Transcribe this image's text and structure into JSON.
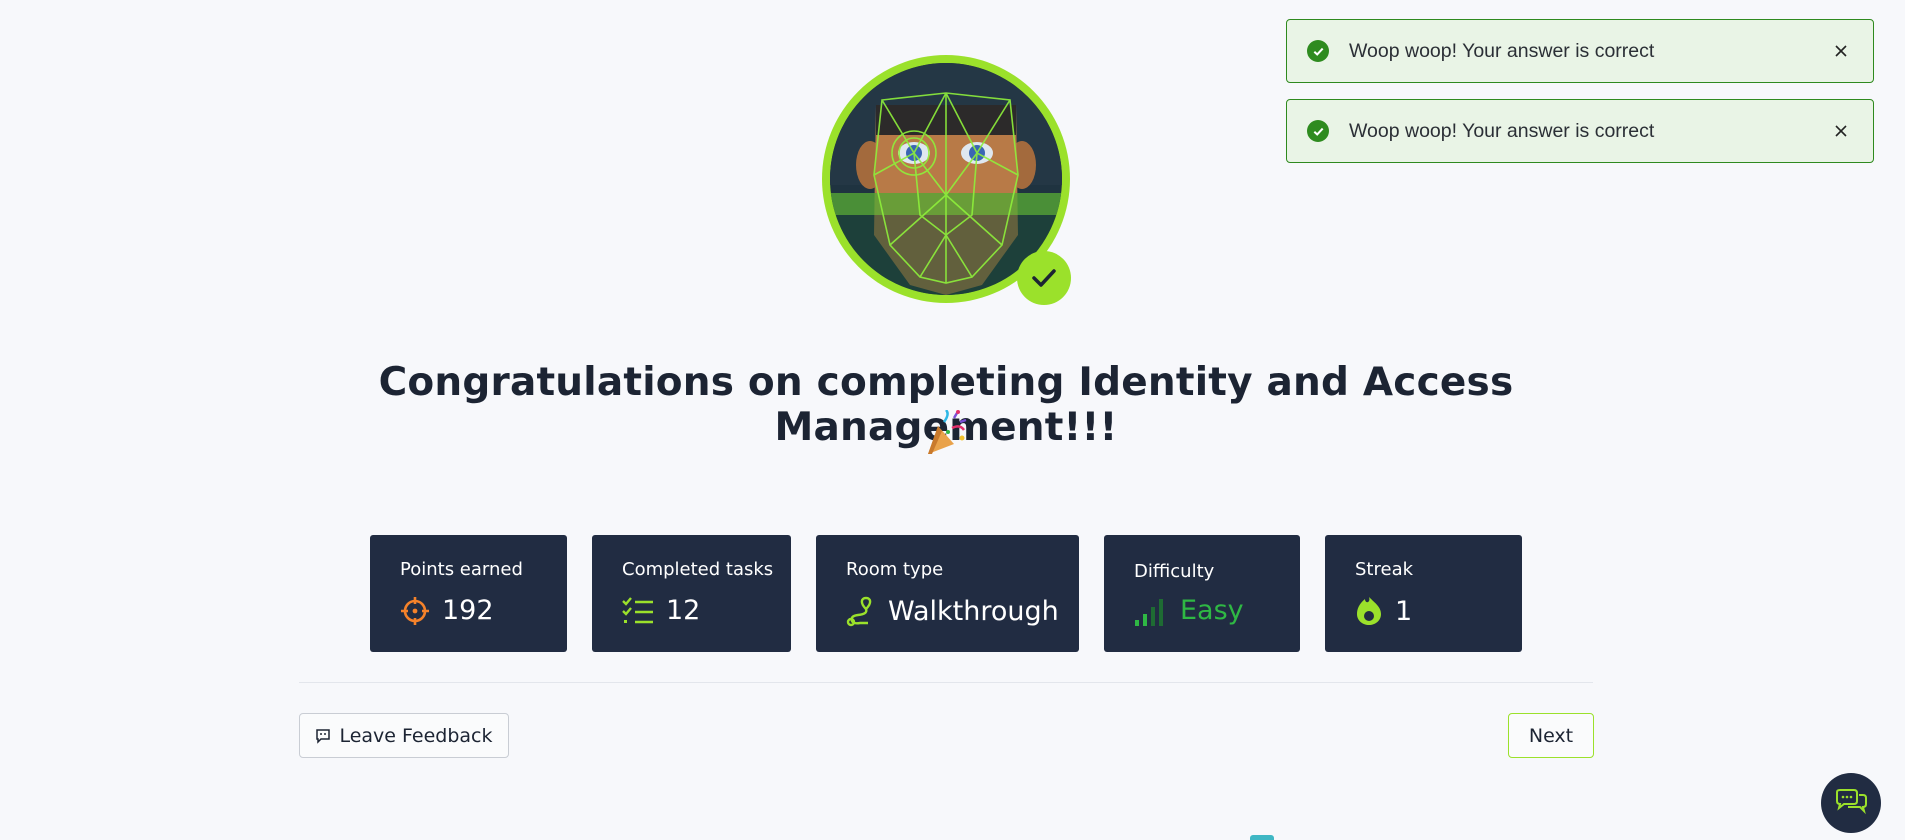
{
  "toasts": [
    {
      "message": "Woop woop! Your answer is correct"
    },
    {
      "message": "Woop woop! Your answer is correct"
    }
  ],
  "title": "Congratulations on completing Identity and Access Management!!!",
  "stats": [
    {
      "label": "Points earned",
      "value": "192",
      "icon": "target-icon"
    },
    {
      "label": "Completed tasks",
      "value": "12",
      "icon": "checklist-icon"
    },
    {
      "label": "Room type",
      "value": "Walkthrough",
      "icon": "route-icon"
    },
    {
      "label": "Difficulty",
      "value": "Easy",
      "icon": "signal-bars-icon"
    },
    {
      "label": "Streak",
      "value": "1",
      "icon": "flame-icon"
    }
  ],
  "actions": {
    "feedback": "Leave Feedback",
    "next": "Next"
  },
  "colors": {
    "accent": "#9be12b",
    "card": "#212c42",
    "success": "#2e8b1f",
    "points": "#f5822a",
    "easy": "#2fb844"
  }
}
